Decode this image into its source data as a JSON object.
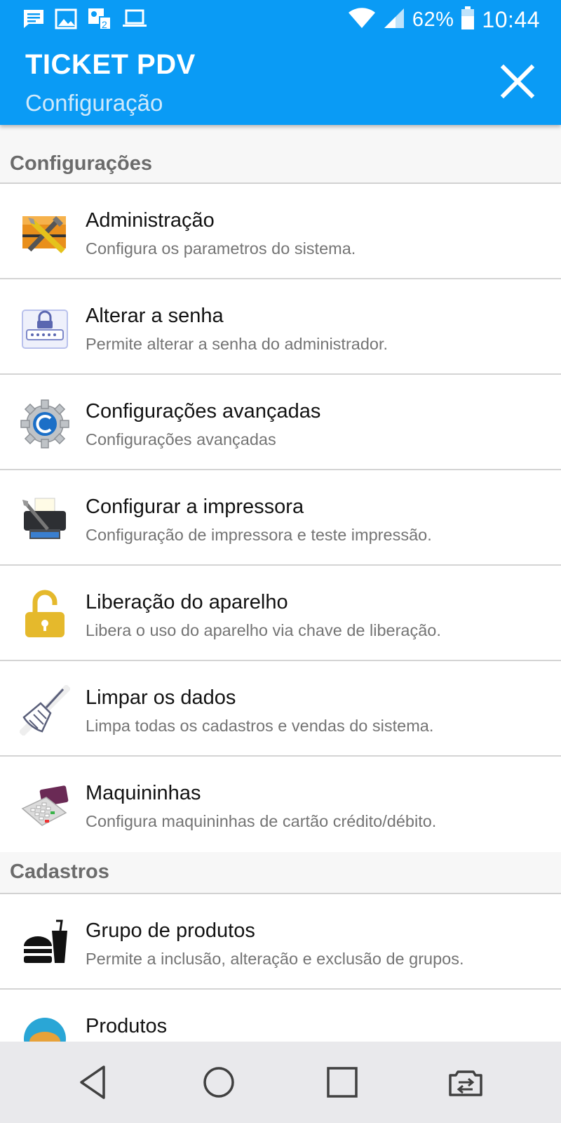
{
  "status_bar": {
    "battery": "62%",
    "time": "10:44",
    "left_icons": [
      "message-icon",
      "image-icon",
      "sim-contacts-icon",
      "laptop-icon"
    ],
    "right_icons": [
      "wifi-icon",
      "signal-icon",
      "battery-icon"
    ]
  },
  "app_bar": {
    "title": "TICKET PDV",
    "subtitle": "Configuração",
    "close_icon": "close-icon"
  },
  "sections": [
    {
      "header": "Configurações",
      "items": [
        {
          "title": "Administração",
          "description": "Configura os parametros do sistema.",
          "icon": "admin-tools-icon"
        },
        {
          "title": "Alterar a senha",
          "description": "Permite alterar a senha do administrador.",
          "icon": "password-lock-icon"
        },
        {
          "title": "Configurações avançadas",
          "description": "Configurações avançadas",
          "icon": "gear-icon"
        },
        {
          "title": "Configurar a impressora",
          "description": "Configuração de impressora e teste impressão.",
          "icon": "printer-icon"
        },
        {
          "title": "Liberação do aparelho",
          "description": "Libera o uso do aparelho via chave de liberação.",
          "icon": "padlock-open-icon"
        },
        {
          "title": "Limpar os dados",
          "description": "Limpa todas os cadastros e vendas do sistema.",
          "icon": "broom-icon"
        },
        {
          "title": "Maquininhas",
          "description": "Configura maquininhas de cartão crédito/débito.",
          "icon": "card-machine-icon"
        }
      ]
    },
    {
      "header": "Cadastros",
      "items": [
        {
          "title": "Grupo de produtos",
          "description": "Permite a inclusão, alteração e exclusão de grupos.",
          "icon": "food-group-icon"
        },
        {
          "title": "Produtos",
          "description": "",
          "icon": "products-icon"
        }
      ]
    }
  ],
  "nav_bar": [
    "back-icon",
    "home-icon",
    "recents-icon",
    "switch-app-icon"
  ],
  "colors": {
    "primary": "#0a9bf5",
    "section_header_text": "#6b6b6b",
    "item_title": "#121212",
    "item_description": "#747474",
    "nav_bar": "#e9e9ec"
  }
}
